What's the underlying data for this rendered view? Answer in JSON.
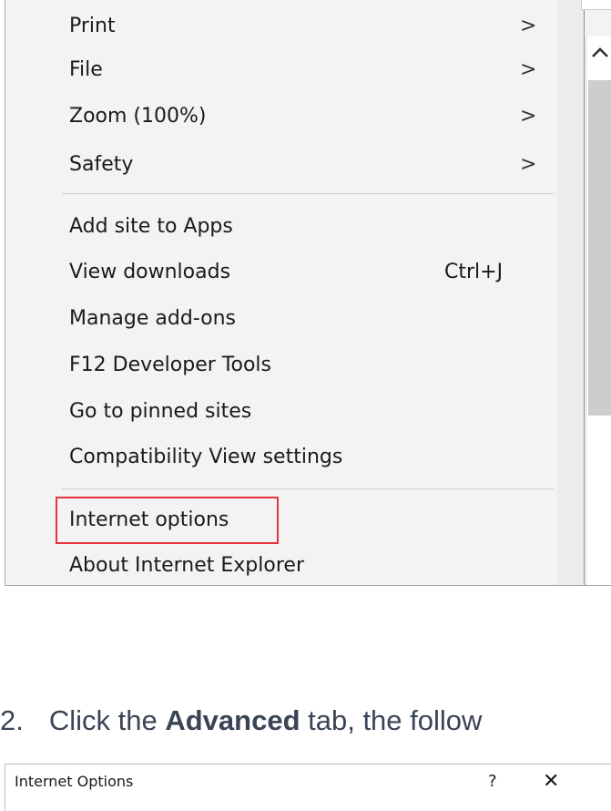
{
  "menu": {
    "items": [
      {
        "label": "Print",
        "arrow": ">",
        "shortcut": ""
      },
      {
        "label": "File",
        "arrow": ">",
        "shortcut": ""
      },
      {
        "label": "Zoom (100%)",
        "arrow": ">",
        "shortcut": ""
      },
      {
        "label": "Safety",
        "arrow": ">",
        "shortcut": ""
      },
      {
        "label": "Add site to Apps",
        "arrow": "",
        "shortcut": ""
      },
      {
        "label": "View downloads",
        "arrow": "",
        "shortcut": "Ctrl+J"
      },
      {
        "label": "Manage add-ons",
        "arrow": "",
        "shortcut": ""
      },
      {
        "label": "F12 Developer Tools",
        "arrow": "",
        "shortcut": ""
      },
      {
        "label": "Go to pinned sites",
        "arrow": "",
        "shortcut": ""
      },
      {
        "label": "Compatibility View settings",
        "arrow": "",
        "shortcut": ""
      },
      {
        "label": "Internet options",
        "arrow": "",
        "shortcut": ""
      },
      {
        "label": "About Internet Explorer",
        "arrow": "",
        "shortcut": ""
      }
    ],
    "highlight_color": "#e8323c"
  },
  "instruction": {
    "number": "2.",
    "before": "Click the ",
    "bold": "Advanced",
    "after": " tab, the follow"
  },
  "dialog": {
    "title": "Internet Options",
    "help": "?",
    "close": "✕"
  }
}
